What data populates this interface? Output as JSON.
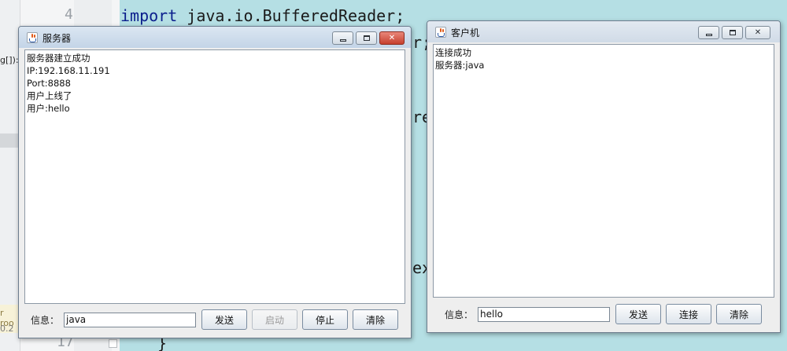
{
  "ide": {
    "line_numbers": [
      "4",
      "17"
    ],
    "code_lines": [
      {
        "keyword": "import",
        "rest": " java.io.BufferedReader;"
      },
      {
        "keyword": "",
        "rest": "r;"
      },
      {
        "keyword": "",
        "rest": "re"
      },
      {
        "keyword": "",
        "rest": "ex"
      },
      {
        "keyword": "",
        "rest": "}"
      }
    ],
    "side_fragments": [
      "g[]):",
      "r roo",
      "0.2"
    ]
  },
  "server": {
    "title": "服务器",
    "log_lines": [
      "服务器建立成功",
      "IP:192.168.11.191",
      "Port:8888",
      "用户上线了",
      "用户:hello"
    ],
    "info_label": "信息：",
    "input_value": "java",
    "buttons": {
      "send": "发送",
      "start": "启动",
      "stop": "停止",
      "clear": "清除"
    }
  },
  "client": {
    "title": "客户机",
    "log_lines": [
      "连接成功",
      "服务器:java"
    ],
    "info_label": "信息：",
    "input_value": "hello",
    "buttons": {
      "send": "发送",
      "connect": "连接",
      "clear": "清除"
    }
  },
  "icons": {
    "window_icon": "java-coffee-icon",
    "minimize": "minimize-icon",
    "maximize": "maximize-icon",
    "close": "close-icon"
  },
  "colors": {
    "close_button": "#c6402e",
    "titlebar": "#c3d4e7",
    "keyword": "#0a1e8c"
  }
}
